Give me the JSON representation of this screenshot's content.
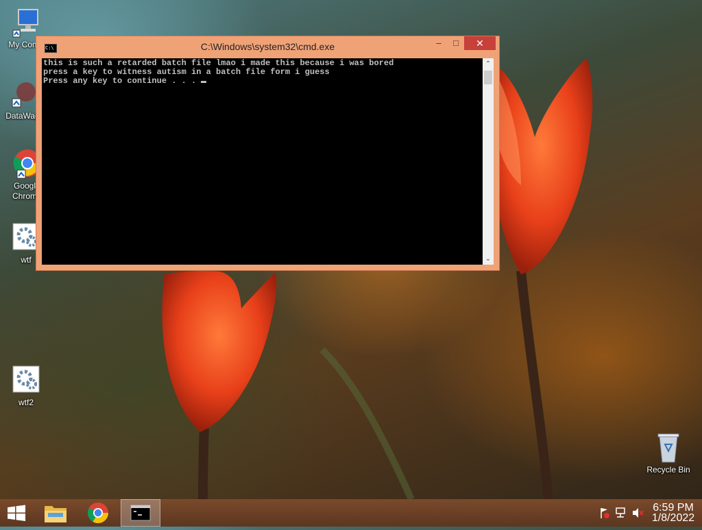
{
  "desktop": {
    "icons": [
      {
        "label": "My Comp",
        "icon": "computer-icon"
      },
      {
        "label": "DataWag",
        "icon": "datawag-icon"
      },
      {
        "label": "Googl Chrom",
        "icon": "chrome-icon"
      },
      {
        "label": "wtf",
        "icon": "batch-file-icon"
      },
      {
        "label": "wtf2",
        "icon": "batch-file-icon"
      },
      {
        "label": "Recycle Bin",
        "icon": "recycle-bin-icon"
      }
    ]
  },
  "window": {
    "title": "C:\\Windows\\system32\\cmd.exe",
    "icon_text": "C:\\",
    "minimize": "–",
    "maximize": "□",
    "close": "✕",
    "console_lines": [
      "this is such a retarded batch file lmao i made this because i was bored",
      "press a key to witness autism in a batch file form i guess",
      "Press any key to continue . . . "
    ]
  },
  "taskbar": {
    "items": [
      "start-icon",
      "file-explorer-icon",
      "chrome-icon",
      "cmd-icon"
    ],
    "active_item": "cmd-icon",
    "tray_icons": [
      "action-center-flag-icon",
      "network-icon",
      "volume-muted-icon"
    ],
    "time": "6:59 PM",
    "date": "1/8/2022"
  },
  "colors": {
    "window_frame": "#f0a277",
    "close_button": "#c7403a",
    "console_bg": "#000000",
    "console_text": "#c0c0c0",
    "taskbar": "#6b3f25"
  }
}
